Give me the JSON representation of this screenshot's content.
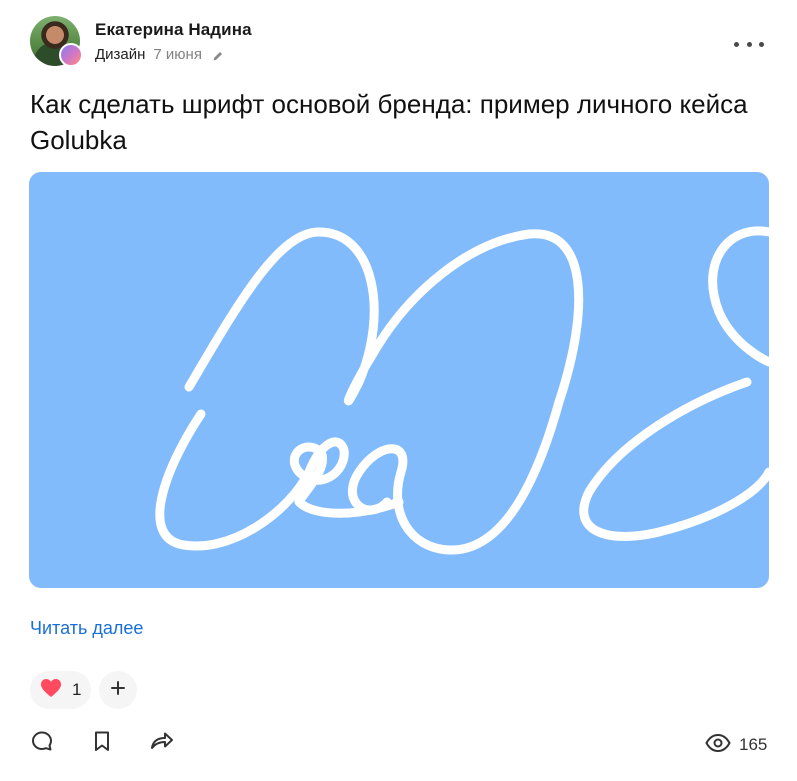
{
  "author": {
    "name": "Екатерина Надина"
  },
  "meta": {
    "category": "Дизайн",
    "date": "7 июня"
  },
  "post": {
    "title": "Как сделать шрифт основой бренда: пример личного кейса Golubka",
    "read_more": "Читать далее"
  },
  "reactions": {
    "like_count": "1"
  },
  "stats": {
    "views": "165"
  },
  "colors": {
    "cover_bg": "#82bbfb",
    "link": "#1a6ed8",
    "heart": "#ff4a5f"
  },
  "icons": {
    "more": "more-horizontal-icon",
    "edit": "pencil-icon",
    "heart": "heart-icon",
    "add_reaction": "plus-icon",
    "comment": "comment-icon",
    "bookmark": "bookmark-icon",
    "share": "share-icon",
    "views": "eye-icon"
  }
}
